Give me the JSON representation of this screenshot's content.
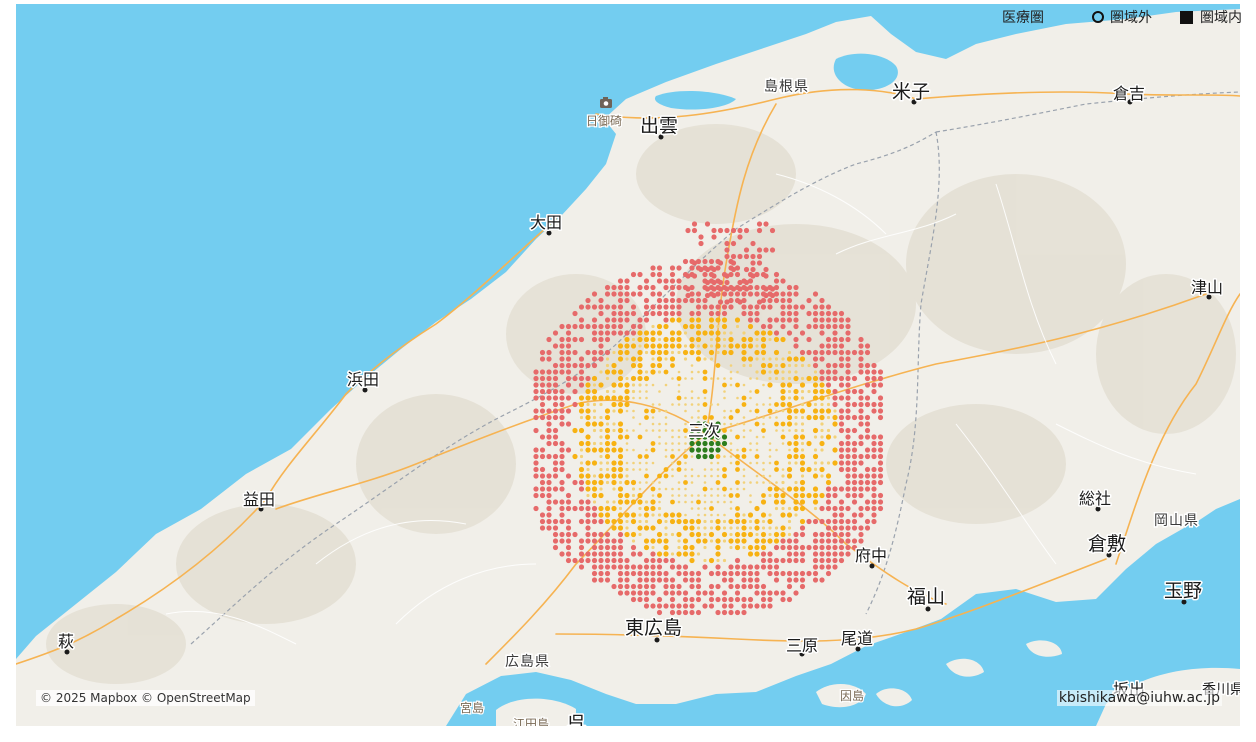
{
  "legend": {
    "title": "医療圏",
    "outside_label": "圏域外",
    "inside_label": "圏域内"
  },
  "attribution": "© 2025 Mapbox © OpenStreetMap",
  "credit": "kbishikawa@iuhw.ac.jp",
  "colors": {
    "sea": "#73cdf0",
    "land": "#f1efe9",
    "hill": "#e5e1d6",
    "road_major": "#f6b352",
    "road_minor": "#ffffff",
    "border": "#9aa2ad",
    "center_green": "#2e7d1e",
    "tier_yellow": "#f7b213",
    "tier_light": "#f2d27a",
    "tier_red": "#e66a6a"
  },
  "places": {
    "izumo": "出雲",
    "hinomisaki": "日御碕",
    "shimane_pref": "島根県",
    "yonago": "米子",
    "kurayoshi": "倉吉",
    "oda": "大田",
    "tsuyama": "津山",
    "hamada": "浜田",
    "miyoshi": "三次",
    "masuda": "益田",
    "soja": "総社",
    "okayama_pref": "岡山県",
    "kurashiki": "倉敷",
    "fuchu": "府中",
    "fukuyama": "福山",
    "tamano": "玉野",
    "hagi": "萩",
    "higashihiroshima": "東広島",
    "mihara": "三原",
    "onomichi": "尾道",
    "hiroshima_pref": "広島県",
    "sakaide": "坂出",
    "kagawa": "香川県",
    "innoshima": "因島",
    "miyajima": "宮島",
    "etajima": "江田島",
    "kure": "呉"
  }
}
